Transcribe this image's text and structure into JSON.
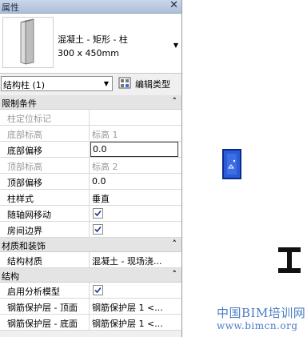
{
  "palette": {
    "title": "属性",
    "close_glyph": "✕"
  },
  "type_selector": {
    "name_line1": "混凝土 - 矩形 - 柱",
    "name_line2": "300 x 450mm"
  },
  "selection": {
    "filter_label": "结构柱 (1)",
    "edit_type_label": "编辑类型"
  },
  "groups": {
    "constraints": "限制条件",
    "materials": "材质和装饰",
    "structure": "结构"
  },
  "rows": {
    "column_location_mark": {
      "label": "柱定位标记",
      "value": ""
    },
    "base_level": {
      "label": "底部标高",
      "value": "标高 1"
    },
    "base_offset": {
      "label": "底部偏移",
      "value": "0.0"
    },
    "top_level": {
      "label": "顶部标高",
      "value": "标高 2"
    },
    "top_offset": {
      "label": "顶部偏移",
      "value": "0.0"
    },
    "column_style": {
      "label": "柱样式",
      "value": "垂直"
    },
    "moves_with_grids": {
      "label": "随轴网移动",
      "checked": true
    },
    "room_bounding": {
      "label": "房间边界",
      "checked": true
    },
    "structural_material": {
      "label": "结构材质",
      "value": "混凝土 - 现场浇..."
    },
    "enable_analytical_model": {
      "label": "启用分析模型",
      "checked": true
    },
    "rebar_cover_top": {
      "label": "钢筋保护层 - 顶面",
      "value": "钢筋保护层 1 <..."
    },
    "rebar_cover_bottom": {
      "label": "钢筋保护层 - 底面",
      "value": "钢筋保护层 1 <..."
    }
  },
  "canvas": {
    "watermark_line1": "中国BIM培训网",
    "watermark_line2": "www.bimcn.org"
  },
  "colors": {
    "column_fill": "#2b5bd7",
    "watermark": "#4a7cc6"
  }
}
